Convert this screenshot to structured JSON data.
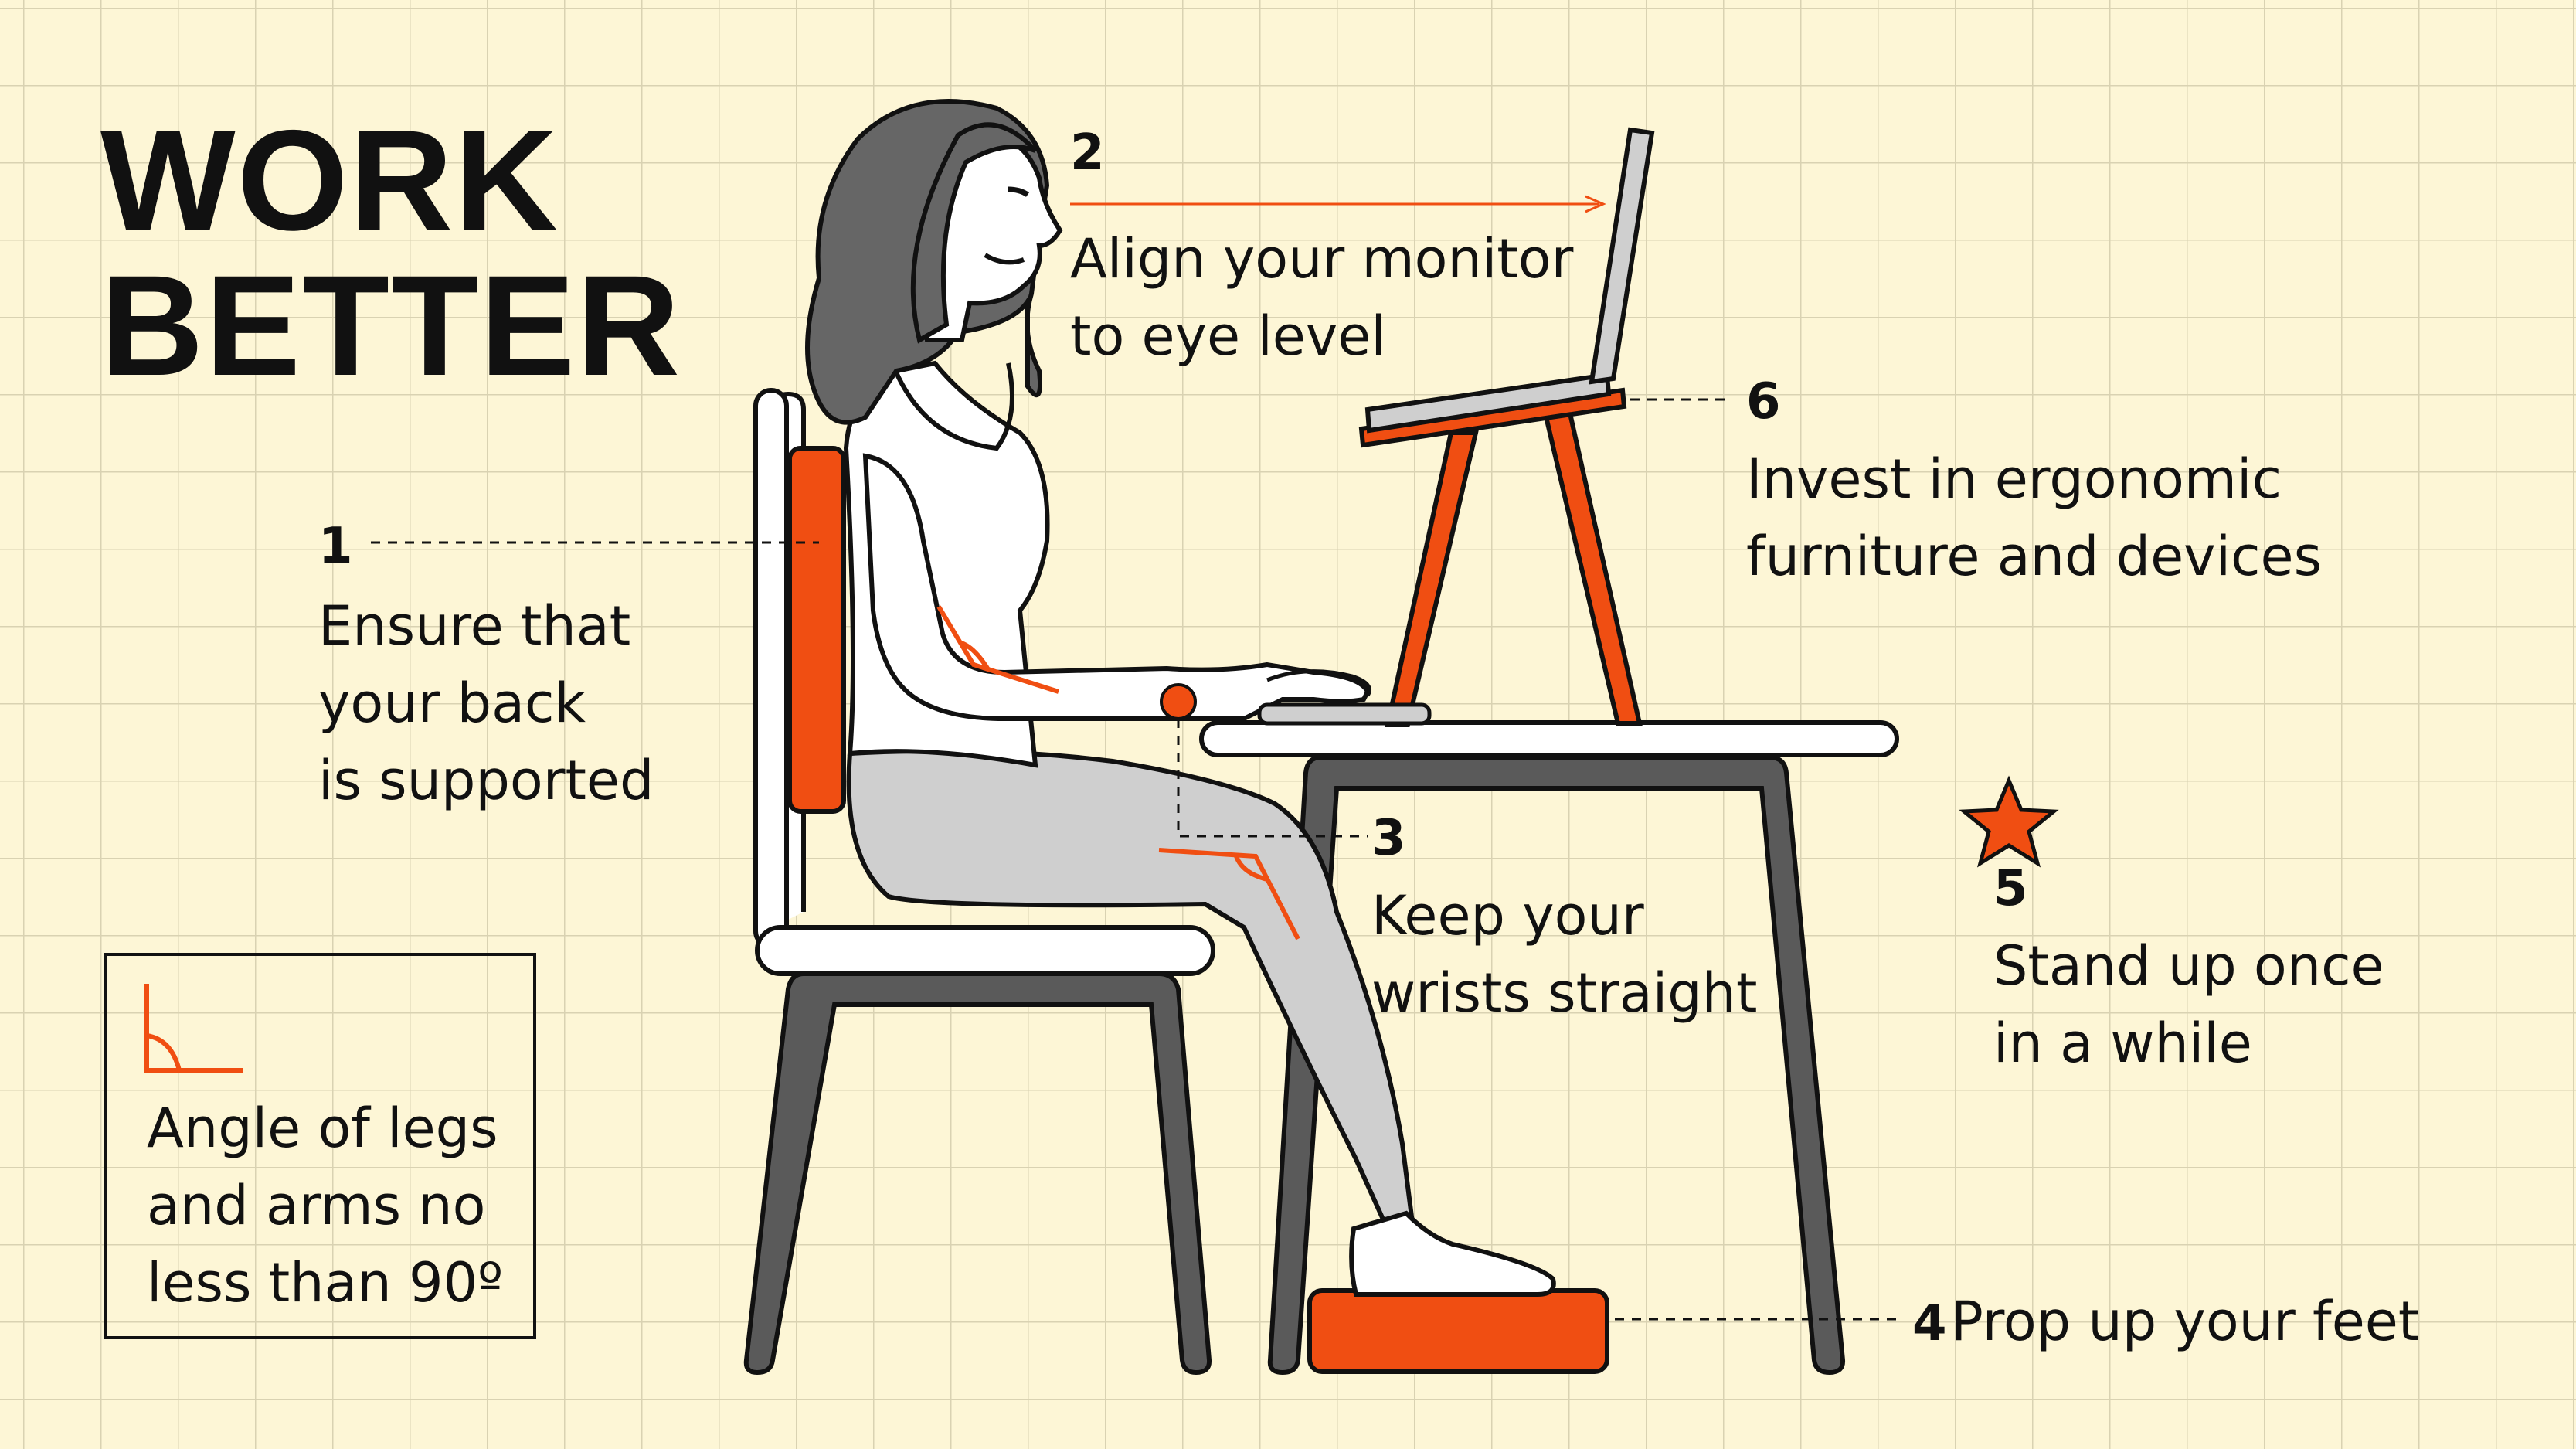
{
  "title": {
    "line1": "WORK",
    "line2": "BETTER"
  },
  "colors": {
    "background": "#fdf6d6",
    "grid": "#d9d2b2",
    "accent": "#f04e12",
    "ink": "#111111",
    "hair": "#666666",
    "skin": "#ffffff",
    "pants": "#cfcfcf",
    "furniture": "#5a5a5a"
  },
  "tips": [
    {
      "number": "1",
      "lines": [
        "Ensure that",
        "your back",
        "is supported"
      ]
    },
    {
      "number": "2",
      "lines": [
        "Align your monitor",
        "to eye level"
      ]
    },
    {
      "number": "3",
      "lines": [
        "Keep your",
        "wrists straight"
      ]
    },
    {
      "number": "4",
      "text": "Prop up your feet"
    },
    {
      "number": "5",
      "lines": [
        "Stand up once",
        "in a while"
      ]
    },
    {
      "number": "6",
      "lines": [
        "Invest in ergonomic",
        "furniture and devices"
      ]
    }
  ],
  "legend": {
    "lines": [
      "Angle of legs",
      "and arms no",
      "less than 90º"
    ]
  }
}
